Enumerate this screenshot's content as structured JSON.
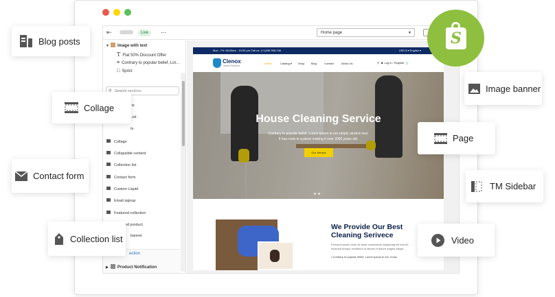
{
  "colors": {
    "window_dot_red": "#ed594a",
    "window_dot_yellow": "#fdd800",
    "window_dot_green": "#5ac05a",
    "shopify_green": "#8ebf3f",
    "site_topbar": "#0d2a64",
    "accent_yellow": "#f2d000"
  },
  "editor": {
    "topbar": {
      "live_badge": "Live",
      "more_icon": "...",
      "page_select": "Home page"
    },
    "sidebar": {
      "tree": {
        "section_title": "Image with text",
        "items": [
          "Flat 50% Discount Offer",
          "Contrary to popular belief, Lor...",
          "Sprict"
        ]
      },
      "search_placeholder": "Search sections",
      "sections": [
        "ns",
        "List",
        "ts",
        "Collage",
        "Collapsible content",
        "Collection list",
        "Contact form",
        "Custom Liquid",
        "Email signup",
        "Featured collection",
        "Featured product",
        "banner"
      ],
      "footer_items": [
        "ection",
        "Product Notification"
      ]
    }
  },
  "site": {
    "topbar_left": "Mon - Fri: 08:00am - 10:00 pm    Call us: (+1)258 908 236",
    "topbar_right": "USD $ ▾    English ▾",
    "logo_name": "Clenox",
    "logo_tagline": "Home Services",
    "nav": [
      "Home",
      "Catalog ▾",
      "Shop",
      "Blog",
      "Contact",
      "About Us"
    ],
    "nav_right": "Log in / Register",
    "hero": {
      "title": "House Cleaning Service",
      "subtitle_line1": "Contrary to popular belief, Lorem Ipsum is not simply random text.",
      "subtitle_line2": "It has roots in a piece making it over 2000 years old.",
      "button": "Our Service"
    },
    "about": {
      "title": "We Provide Our Best Cleaning Serivece",
      "text": "Precious ipsum dolor sit amet consectetur adipiscing elit sed do eiusmod tempor incididunt ut labore et dolore magna aliqua.",
      "bullet": "Contrary to popular belief, Lorem Ipsum is not. It has"
    }
  },
  "floating_labels": {
    "blog_posts": "Blog posts",
    "collage": "Collage",
    "contact_form": "Contact form",
    "collection_list": "Collection list",
    "image_banner": "Image banner",
    "page": "Page",
    "tm_sidebar": "TM Sidebar",
    "video": "Video"
  }
}
